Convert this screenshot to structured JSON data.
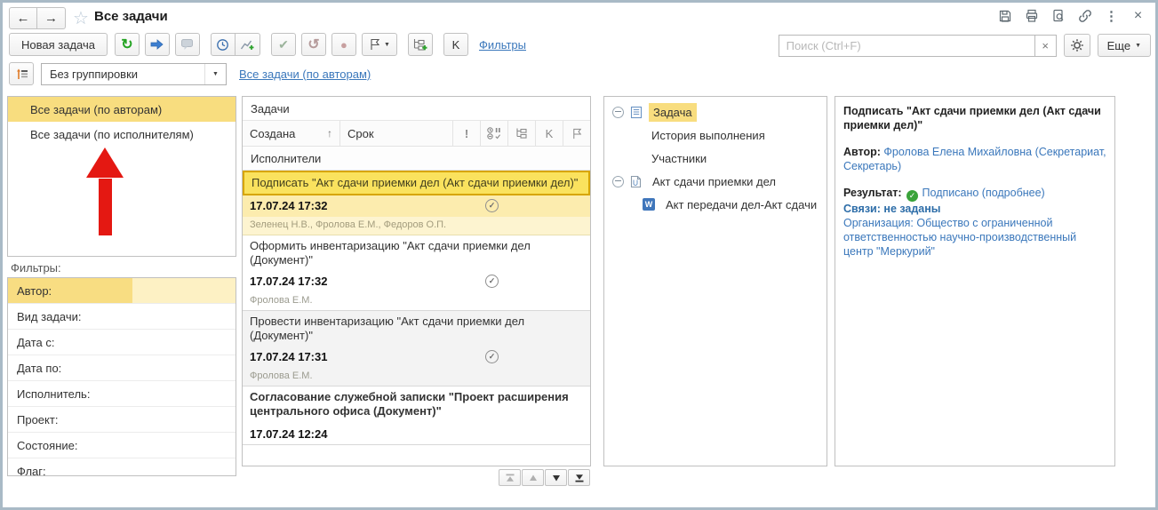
{
  "window": {
    "title": "Все задачи"
  },
  "icons": {
    "back": "←",
    "forward": "→",
    "star": "☆",
    "menu_dots": "⋮",
    "close": "×",
    "caret": "▼",
    "refresh": "↻",
    "check": "✔",
    "undo": "↺",
    "stop": "●",
    "exclamation": "!",
    "k": "K",
    "sort_asc": "↑",
    "clear": "×",
    "done": "✓",
    "w_letter": "W"
  },
  "colors": {
    "selection_yellow": "#f8dd7f",
    "selected_task_yellow": "#fae25e",
    "selected_task_border": "#d7a500",
    "link_blue": "#3a77bb",
    "annotation_red": "#e41812",
    "result_green": "#3aa33a"
  },
  "toolbar": {
    "new_task_label": "Новая задача",
    "k_label": "K",
    "filters_link": "Фильтры",
    "search_placeholder": "Поиск (Ctrl+F)",
    "more_label": "Еще"
  },
  "grouping": {
    "value": "Без группировки",
    "link": "Все задачи (по авторам)"
  },
  "nav_list": {
    "items": [
      {
        "label": "Все задачи (по авторам)",
        "selected": true
      },
      {
        "label": "Все задачи (по исполнителям)",
        "selected": false
      }
    ]
  },
  "filters": {
    "title": "Фильтры:",
    "rows": [
      "Автор:",
      "Вид задачи:",
      "Дата с:",
      "Дата по:",
      "Исполнитель:",
      "Проект:",
      "Состояние:",
      "Флаг:"
    ]
  },
  "tasks": {
    "panel_title": "Задачи",
    "columns": {
      "created": "Создана",
      "due": "Срок"
    },
    "subheader": "Исполнители",
    "items": [
      {
        "title": "Подписать \"Акт сдачи приемки дел (Акт сдачи приемки дел)\"",
        "created": "17.07.24 17:32",
        "executors": "Зеленец Н.В., Фролова Е.М., Федоров О.П."
      },
      {
        "title": "Оформить инвентаризацию \"Акт сдачи приемки дел (Документ)\"",
        "created": "17.07.24 17:32",
        "executors": "Фролова Е.М."
      },
      {
        "title": "Провести инвентаризацию \"Акт сдачи приемки дел (Документ)\"",
        "created": "17.07.24 17:31",
        "executors": "Фролова Е.М."
      },
      {
        "title": "Согласование служебной записки \"Проект расширения центрального офиса (Документ)\"",
        "created": "17.07.24 12:24",
        "executors": ""
      }
    ]
  },
  "tree": {
    "items": [
      {
        "label": "Задача"
      },
      {
        "label": "История выполнения"
      },
      {
        "label": "Участники"
      },
      {
        "label": "Акт сдачи приемки дел"
      },
      {
        "label": "Акт передачи дел-Акт сдачи"
      }
    ]
  },
  "details": {
    "title": "Подписать \"Акт сдачи приемки дел (Акт сдачи приемки дел)\"",
    "author_label": "Автор:",
    "author": "Фролова Елена Михайловна (Секретариат, Секретарь)",
    "result_label": "Результат:",
    "result_value": "Подписано",
    "result_more": "(подробнее)",
    "links_label": "Связи:",
    "links_value": "не заданы",
    "org_label": "Организация:",
    "org_value": "Общество с ограниченной ответственностью научно-производственный центр \"Меркурий\""
  }
}
